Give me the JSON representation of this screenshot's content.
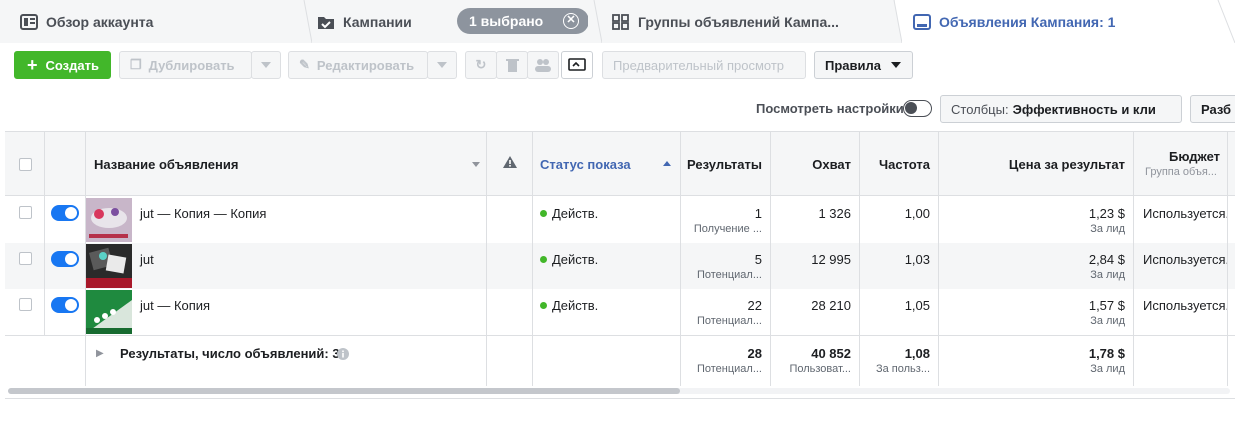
{
  "tabs": {
    "overview": "Обзор аккаунта",
    "campaigns": "Кампании",
    "selected": "1 выбрано",
    "adsets": "Группы объявлений Кампа...",
    "ads": "Объявления Кампания: 1"
  },
  "toolbar": {
    "create": "Создать",
    "duplicate": "Дублировать",
    "edit": "Редактировать",
    "preview": "Предварительный просмотр",
    "rules": "Правила",
    "view_settings": "Посмотреть настройки",
    "columns_prefix": "Столбцы:",
    "columns_value": "Эффективность и кли",
    "breakdown": "Разб"
  },
  "table": {
    "headers": {
      "name": "Название объявления",
      "status": "Статус показа",
      "results": "Результаты",
      "reach": "Охват",
      "frequency": "Частота",
      "cost": "Цена за результат",
      "budget": "Бюджет",
      "budget_sub": "Группа объя..."
    },
    "rows": [
      {
        "name": "jut — Копия — Копия",
        "status": "Действ.",
        "results": "1",
        "results_sub": "Получение ...",
        "reach": "1 326",
        "frequency": "1,00",
        "cost": "1,23 $",
        "cost_sub": "За лид",
        "budget": "Используется..."
      },
      {
        "name": "jut",
        "status": "Действ.",
        "results": "5",
        "results_sub": "Потенциал...",
        "reach": "12 995",
        "frequency": "1,03",
        "cost": "2,84 $",
        "cost_sub": "За лид",
        "budget": "Используется..."
      },
      {
        "name": "jut — Копия",
        "status": "Действ.",
        "results": "22",
        "results_sub": "Потенциал...",
        "reach": "28 210",
        "frequency": "1,05",
        "cost": "1,57 $",
        "cost_sub": "За лид",
        "budget": "Используется..."
      }
    ],
    "total": {
      "label": "Результаты, число объявлений: 3",
      "results": "28",
      "results_sub": "Потенциал...",
      "reach": "40 852",
      "reach_sub": "Пользоват...",
      "frequency": "1,08",
      "frequency_sub": "За польз...",
      "cost": "1,78 $",
      "cost_sub": "За лид"
    }
  },
  "colors": {
    "accent": "#4267b2",
    "create": "#42b72a",
    "toggle": "#1877f2",
    "active_dot": "#42b72a"
  }
}
